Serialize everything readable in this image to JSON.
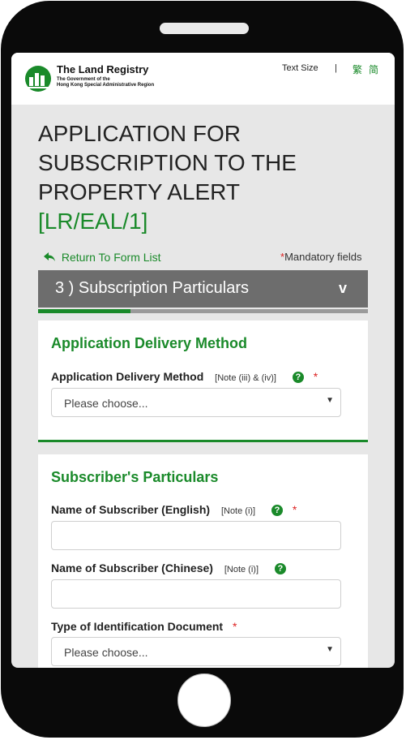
{
  "header": {
    "org_name": "The Land Registry",
    "org_sub_line1": "The Government of the",
    "org_sub_line2": "Hong Kong Special Administrative Region",
    "text_size_label": "Text Size",
    "separator": "|",
    "lang_traditional": "繁",
    "lang_simplified": "简"
  },
  "page": {
    "title": "APPLICATION FOR SUBSCRIPTION TO THE PROPERTY ALERT",
    "form_code": "[LR/EAL/1]"
  },
  "nav": {
    "return_label": "Return To Form List",
    "mandatory_star": "*",
    "mandatory_label": "Mandatory fields"
  },
  "section": {
    "title": "3 ) Subscription Particulars",
    "chevron": "v",
    "progress": 0.28
  },
  "delivery_card": {
    "title": "Application Delivery Method",
    "field_label": "Application Delivery Method",
    "field_note": "[Note (iii) & (iv)]",
    "required_star": "*",
    "select_value": "Please choose..."
  },
  "subscriber_card": {
    "title": "Subscriber's Particulars",
    "name_en_label": "Name of Subscriber (English)",
    "name_en_note": "[Note (i)]",
    "name_en_star": "*",
    "name_zh_label": "Name of Subscriber (Chinese)",
    "name_zh_note": "[Note (i)]",
    "id_type_label": "Type of Identification Document",
    "id_type_star": "*",
    "id_type_value": "Please choose..."
  },
  "icons": {
    "help": "?",
    "caret": "▼",
    "back_arrow": "🡸"
  },
  "colors": {
    "accent_green": "#1a8a2a",
    "section_bar": "#6d6d6d",
    "required_red": "#d22222",
    "phone_body": "#0a0a0a"
  }
}
